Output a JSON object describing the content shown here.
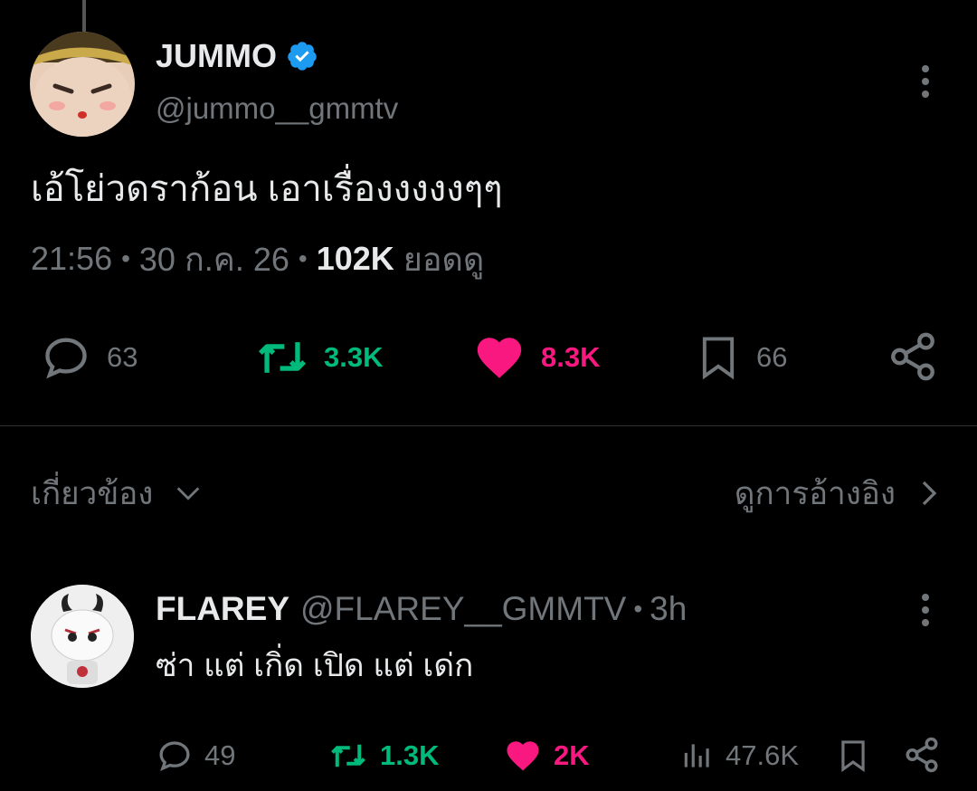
{
  "tweet": {
    "display_name": "JUMMO",
    "handle": "@jummo__gmmtv",
    "text": "เอ้โย่วดราก้อน เอาเรื่องงงงงๆๆ",
    "time": "21:56",
    "date": "30 ก.ค. 26",
    "sep": "•",
    "views_count": "102K",
    "views_label": "ยอดดู",
    "replies": "63",
    "retweets": "3.3K",
    "likes": "8.3K",
    "bookmarks": "66"
  },
  "section": {
    "related_label": "เกี่ยวข้อง",
    "quotes_label": "ดูการอ้างอิง"
  },
  "reply": {
    "display_name": "FLAREY",
    "handle": "@FLAREY__GMMTV",
    "sep": "•",
    "time": "3h",
    "text": "ซ่า แต่ เกิ่ด เปิด แต่ เด่ก",
    "replies": "49",
    "retweets": "1.3K",
    "likes": "2K",
    "views": "47.6K"
  },
  "colors": {
    "background": "#000000",
    "text": "#e7e9ea",
    "muted": "#71767b",
    "verified": "#1d9bf0",
    "retweet": "#00ba7c",
    "like": "#f91880"
  },
  "icons": [
    "verified-badge-icon",
    "more-icon",
    "reply-icon",
    "retweet-icon",
    "like-icon",
    "bookmark-icon",
    "share-icon",
    "chevron-down-icon",
    "chevron-right-icon",
    "views-icon"
  ]
}
